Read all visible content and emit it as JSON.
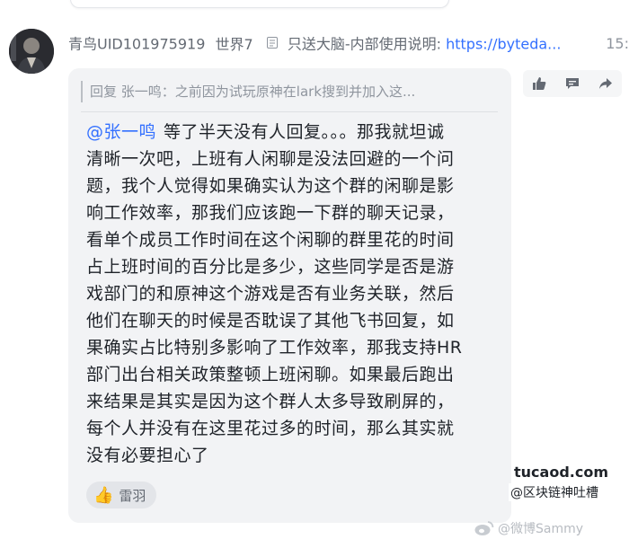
{
  "header": {
    "sender_name": "青鸟UID101975919",
    "department": "世界7",
    "pinned_doc_title": "只送大脑-内部使用说明:",
    "pinned_doc_url": "https://byteda...",
    "time": "15:"
  },
  "reply": {
    "prefix": "回复",
    "quoted_text": "张一鸣：之前因为试玩原神在lark搜到并加入这..."
  },
  "message": {
    "mention": "@张一鸣",
    "lines": [
      "等了半天没有人回复。。。那我就坦诚",
      "清晰一次吧，上班有人闲聊是没法回避的一个问",
      "题，我个人觉得如果确实认为这个群的闲聊是影",
      "响工作效率，那我们应该跑一下群的聊天记录，",
      "看单个成员工作时间在这个闲聊的群里花的时间",
      "占上班时间的百分比是多少，这些同学是否是游",
      "戏部门的和原神这个游戏是否有业务关联，然后",
      "他们在聊天的时候是否耽误了其他飞书回复，如",
      "果确实占比特别多影响了工作效率，那我支持HR",
      "部门出台相关政策整顿上班闲聊。如果最后跑出",
      "来结果是其实是因为这个群人太多导致刷屏的，",
      "每个人并没有在这里花过多的时间，那么其实就",
      "没有必要担心了"
    ]
  },
  "reaction": {
    "emoji": "👍",
    "users": "雷羽"
  },
  "toolbar": {
    "icons": [
      "thumbs-up-icon",
      "comment-icon",
      "share-icon"
    ]
  },
  "watermark": {
    "site": "tucaod.com",
    "handle": "@区块链神吐槽",
    "weibo": "@微博Sammy"
  },
  "colors": {
    "bubble": "#f2f3f5",
    "link": "#3370ff",
    "muted": "#8f959e"
  }
}
